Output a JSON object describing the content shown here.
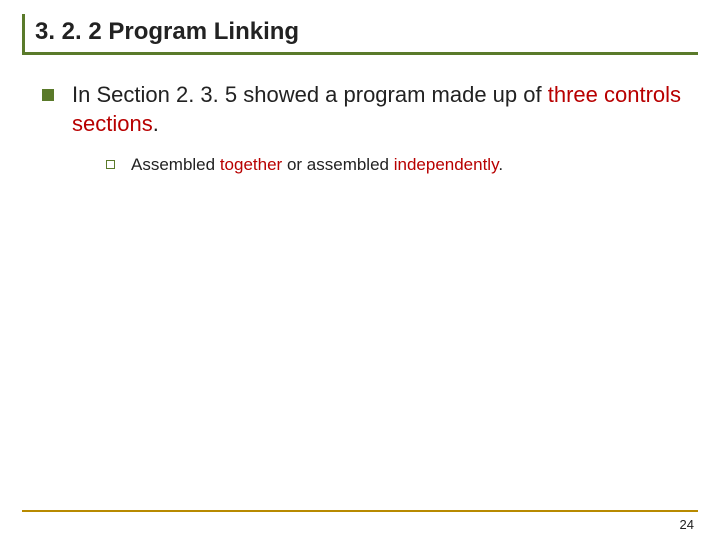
{
  "title": "3. 2. 2  Program Linking",
  "bullet": {
    "pre": "In Section 2. 3. 5 showed a program made up of ",
    "em": "three controls sections",
    "post": "."
  },
  "sub": {
    "pre": "Assembled ",
    "em1": "together",
    "mid": " or assembled ",
    "em2": "independently",
    "post": "."
  },
  "page": "24"
}
